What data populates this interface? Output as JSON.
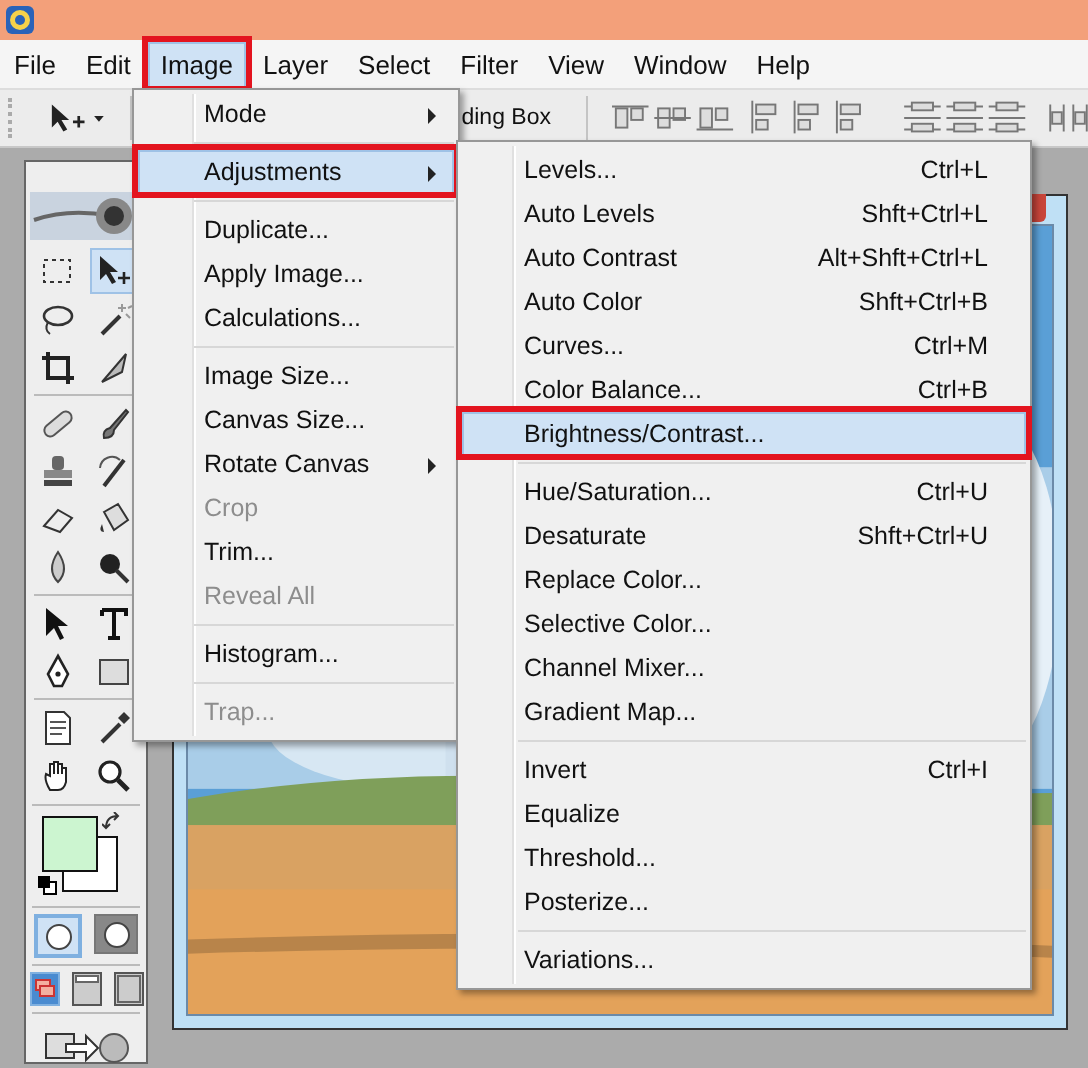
{
  "menu_bar": [
    {
      "label": "File",
      "selected": false,
      "annotated": false
    },
    {
      "label": "Edit",
      "selected": false,
      "annotated": false
    },
    {
      "label": "Image",
      "selected": true,
      "annotated": true
    },
    {
      "label": "Layer",
      "selected": false,
      "annotated": false
    },
    {
      "label": "Select",
      "selected": false,
      "annotated": false
    },
    {
      "label": "Filter",
      "selected": false,
      "annotated": false
    },
    {
      "label": "View",
      "selected": false,
      "annotated": false
    },
    {
      "label": "Window",
      "selected": false,
      "annotated": false
    },
    {
      "label": "Help",
      "selected": false,
      "annotated": false
    }
  ],
  "options_bar": {
    "partial_label": "ding Box"
  },
  "toolbox": {
    "tools": [
      {
        "kind": "marquee",
        "selected": false
      },
      {
        "kind": "move",
        "selected": true
      },
      {
        "kind": "lasso",
        "selected": false
      },
      {
        "kind": "wand",
        "selected": false
      },
      {
        "kind": "crop",
        "selected": false
      },
      {
        "kind": "slice",
        "selected": false
      },
      {
        "kind": "separator"
      },
      {
        "kind": "heal",
        "selected": false
      },
      {
        "kind": "brush",
        "selected": false
      },
      {
        "kind": "stamp",
        "selected": false
      },
      {
        "kind": "history",
        "selected": false
      },
      {
        "kind": "eraser",
        "selected": false
      },
      {
        "kind": "bucket",
        "selected": false
      },
      {
        "kind": "blur",
        "selected": false
      },
      {
        "kind": "dodge",
        "selected": false
      },
      {
        "kind": "separator"
      },
      {
        "kind": "arrow",
        "selected": false
      },
      {
        "kind": "type",
        "selected": false
      },
      {
        "kind": "pen",
        "selected": false
      },
      {
        "kind": "shape",
        "selected": false
      },
      {
        "kind": "separator"
      },
      {
        "kind": "notes",
        "selected": false
      },
      {
        "kind": "eyedropper",
        "selected": false
      },
      {
        "kind": "hand",
        "selected": false
      },
      {
        "kind": "zoom",
        "selected": false
      }
    ],
    "mask_modes": [
      {
        "kind": "standard",
        "selected": true
      },
      {
        "kind": "quick",
        "selected": false
      }
    ],
    "screen_modes": [
      {
        "kind": "window",
        "selected": true
      },
      {
        "kind": "menu",
        "selected": false
      },
      {
        "kind": "full",
        "selected": false
      }
    ]
  },
  "image_menu": {
    "items": [
      {
        "kind": "item",
        "label": "Mode",
        "submenu": true,
        "disabled": false,
        "selected": false,
        "annotated": false
      },
      {
        "kind": "separator"
      },
      {
        "kind": "item",
        "label": "Adjustments",
        "submenu": true,
        "disabled": false,
        "selected": true,
        "annotated": true
      },
      {
        "kind": "separator"
      },
      {
        "kind": "item",
        "label": "Duplicate...",
        "submenu": false,
        "disabled": false,
        "selected": false,
        "annotated": false
      },
      {
        "kind": "item",
        "label": "Apply Image...",
        "submenu": false,
        "disabled": false,
        "selected": false,
        "annotated": false
      },
      {
        "kind": "item",
        "label": "Calculations...",
        "submenu": false,
        "disabled": false,
        "selected": false,
        "annotated": false
      },
      {
        "kind": "separator"
      },
      {
        "kind": "item",
        "label": "Image Size...",
        "submenu": false,
        "disabled": false,
        "selected": false,
        "annotated": false
      },
      {
        "kind": "item",
        "label": "Canvas Size...",
        "submenu": false,
        "disabled": false,
        "selected": false,
        "annotated": false
      },
      {
        "kind": "item",
        "label": "Rotate Canvas",
        "submenu": true,
        "disabled": false,
        "selected": false,
        "annotated": false
      },
      {
        "kind": "item",
        "label": "Crop",
        "submenu": false,
        "disabled": true,
        "selected": false,
        "annotated": false
      },
      {
        "kind": "item",
        "label": "Trim...",
        "submenu": false,
        "disabled": false,
        "selected": false,
        "annotated": false
      },
      {
        "kind": "item",
        "label": "Reveal All",
        "submenu": false,
        "disabled": true,
        "selected": false,
        "annotated": false
      },
      {
        "kind": "separator"
      },
      {
        "kind": "item",
        "label": "Histogram...",
        "submenu": false,
        "disabled": false,
        "selected": false,
        "annotated": false
      },
      {
        "kind": "separator"
      },
      {
        "kind": "item",
        "label": "Trap...",
        "submenu": false,
        "disabled": true,
        "selected": false,
        "annotated": false
      }
    ]
  },
  "adjustments_menu": {
    "items": [
      {
        "kind": "item",
        "label": "Levels...",
        "shortcut": "Ctrl+L",
        "selected": false,
        "annotated": false
      },
      {
        "kind": "item",
        "label": "Auto Levels",
        "shortcut": "Shft+Ctrl+L",
        "selected": false,
        "annotated": false
      },
      {
        "kind": "item",
        "label": "Auto Contrast",
        "shortcut": "Alt+Shft+Ctrl+L",
        "selected": false,
        "annotated": false
      },
      {
        "kind": "item",
        "label": "Auto Color",
        "shortcut": "Shft+Ctrl+B",
        "selected": false,
        "annotated": false
      },
      {
        "kind": "item",
        "label": "Curves...",
        "shortcut": "Ctrl+M",
        "selected": false,
        "annotated": false
      },
      {
        "kind": "item",
        "label": "Color Balance...",
        "shortcut": "Ctrl+B",
        "selected": false,
        "annotated": false
      },
      {
        "kind": "item",
        "label": "Brightness/Contrast...",
        "selected": true,
        "annotated": true
      },
      {
        "kind": "separator"
      },
      {
        "kind": "item",
        "label": "Hue/Saturation...",
        "shortcut": "Ctrl+U",
        "selected": false,
        "annotated": false
      },
      {
        "kind": "item",
        "label": "Desaturate",
        "shortcut": "Shft+Ctrl+U",
        "selected": false,
        "annotated": false
      },
      {
        "kind": "item",
        "label": "Replace Color...",
        "selected": false,
        "annotated": false
      },
      {
        "kind": "item",
        "label": "Selective Color...",
        "selected": false,
        "annotated": false
      },
      {
        "kind": "item",
        "label": "Channel Mixer...",
        "selected": false,
        "annotated": false
      },
      {
        "kind": "item",
        "label": "Gradient Map...",
        "selected": false,
        "annotated": false
      },
      {
        "kind": "separator"
      },
      {
        "kind": "item",
        "label": "Invert",
        "shortcut": "Ctrl+I",
        "selected": false,
        "annotated": false
      },
      {
        "kind": "item",
        "label": "Equalize",
        "selected": false,
        "annotated": false
      },
      {
        "kind": "item",
        "label": "Threshold...",
        "selected": false,
        "annotated": false
      },
      {
        "kind": "item",
        "label": "Posterize...",
        "selected": false,
        "annotated": false
      },
      {
        "kind": "separator"
      },
      {
        "kind": "item",
        "label": "Variations...",
        "selected": false,
        "annotated": false
      }
    ]
  }
}
